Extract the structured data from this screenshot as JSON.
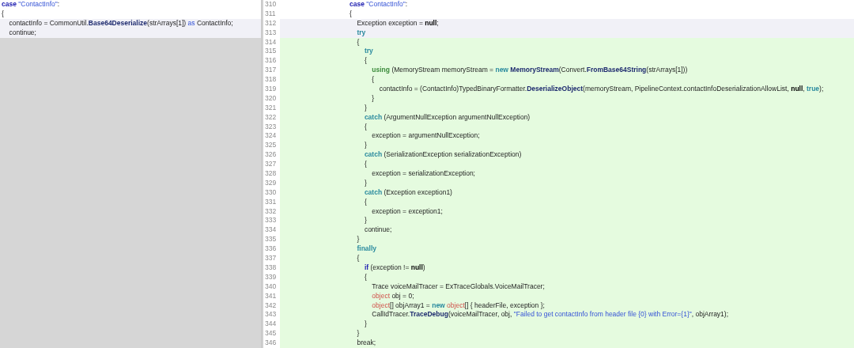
{
  "left": {
    "lines": [
      {
        "added": false,
        "changed": false,
        "tokens": [
          {
            "kind": "keyword",
            "text": "case"
          },
          {
            "kind": "string",
            "text": " \"ContactInfo\""
          },
          {
            "kind": "plain",
            "text": ":"
          }
        ]
      },
      {
        "added": false,
        "changed": false,
        "tokens": [
          {
            "kind": "plain",
            "text": "{"
          }
        ]
      },
      {
        "added": false,
        "changed": true,
        "tokens": [
          {
            "kind": "plain",
            "text": "    contactInfo = CommonUtil."
          },
          {
            "kind": "method",
            "text": "Base64Deserialize"
          },
          {
            "kind": "plain",
            "text": "(strArrays[1]) "
          },
          {
            "kind": "keyword-light",
            "text": "as"
          },
          {
            "kind": "plain",
            "text": " ContactInfo;"
          }
        ]
      },
      {
        "added": false,
        "changed": true,
        "tokens": [
          {
            "kind": "plain",
            "text": "    continue;"
          }
        ]
      }
    ]
  },
  "right": {
    "lines": [
      {
        "number": "310",
        "added": false,
        "changed": false,
        "tokens": [
          {
            "kind": "keyword",
            "text": "case"
          },
          {
            "kind": "string",
            "text": " \"ContactInfo\""
          },
          {
            "kind": "plain",
            "text": ":"
          }
        ]
      },
      {
        "number": "311",
        "added": false,
        "changed": false,
        "tokens": [
          {
            "kind": "plain",
            "text": "{"
          }
        ]
      },
      {
        "number": "312",
        "added": false,
        "changed": true,
        "tokens": [
          {
            "kind": "plain",
            "text": "    Exception exception = "
          },
          {
            "kind": "literal",
            "text": "null"
          },
          {
            "kind": "plain",
            "text": ";"
          }
        ]
      },
      {
        "number": "313",
        "added": false,
        "changed": true,
        "tokens": [
          {
            "kind": "control",
            "text": "    try"
          }
        ]
      },
      {
        "number": "314",
        "added": true,
        "changed": false,
        "tokens": [
          {
            "kind": "plain",
            "text": "    {"
          }
        ]
      },
      {
        "number": "315",
        "added": true,
        "changed": false,
        "tokens": [
          {
            "kind": "control",
            "text": "        try"
          }
        ]
      },
      {
        "number": "316",
        "added": true,
        "changed": false,
        "tokens": [
          {
            "kind": "plain",
            "text": "        {"
          }
        ]
      },
      {
        "number": "317",
        "added": true,
        "changed": false,
        "tokens": [
          {
            "kind": "using",
            "text": "            using"
          },
          {
            "kind": "plain",
            "text": " (MemoryStream memoryStream = "
          },
          {
            "kind": "control",
            "text": "new"
          },
          {
            "kind": "method",
            "text": " MemoryStream"
          },
          {
            "kind": "plain",
            "text": "(Convert."
          },
          {
            "kind": "method",
            "text": "FromBase64String"
          },
          {
            "kind": "plain",
            "text": "(strArrays[1]))"
          }
        ]
      },
      {
        "number": "318",
        "added": true,
        "changed": false,
        "tokens": [
          {
            "kind": "plain",
            "text": "            {"
          }
        ]
      },
      {
        "number": "319",
        "added": true,
        "changed": false,
        "tokens": [
          {
            "kind": "plain",
            "text": "                contactInfo = (ContactInfo)TypedBinaryFormatter."
          },
          {
            "kind": "method",
            "text": "DeserializeObject"
          },
          {
            "kind": "plain",
            "text": "(memoryStream, PipelineContext.contactInfoDeserializationAllowList, "
          },
          {
            "kind": "literal",
            "text": "null"
          },
          {
            "kind": "plain",
            "text": ","
          },
          {
            "kind": "control",
            "text": " true"
          },
          {
            "kind": "plain",
            "text": ");"
          }
        ]
      },
      {
        "number": "320",
        "added": true,
        "changed": false,
        "tokens": [
          {
            "kind": "plain",
            "text": "            }"
          }
        ]
      },
      {
        "number": "321",
        "added": true,
        "changed": false,
        "tokens": [
          {
            "kind": "plain",
            "text": "        }"
          }
        ]
      },
      {
        "number": "322",
        "added": true,
        "changed": false,
        "tokens": [
          {
            "kind": "control",
            "text": "        catch"
          },
          {
            "kind": "plain",
            "text": " (ArgumentNullException argumentNullException)"
          }
        ]
      },
      {
        "number": "323",
        "added": true,
        "changed": false,
        "tokens": [
          {
            "kind": "plain",
            "text": "        {"
          }
        ]
      },
      {
        "number": "324",
        "added": true,
        "changed": false,
        "tokens": [
          {
            "kind": "plain",
            "text": "            exception = argumentNullException;"
          }
        ]
      },
      {
        "number": "325",
        "added": true,
        "changed": false,
        "tokens": [
          {
            "kind": "plain",
            "text": "        }"
          }
        ]
      },
      {
        "number": "326",
        "added": true,
        "changed": false,
        "tokens": [
          {
            "kind": "control",
            "text": "        catch"
          },
          {
            "kind": "plain",
            "text": " (SerializationException serializationException)"
          }
        ]
      },
      {
        "number": "327",
        "added": true,
        "changed": false,
        "tokens": [
          {
            "kind": "plain",
            "text": "        {"
          }
        ]
      },
      {
        "number": "328",
        "added": true,
        "changed": false,
        "tokens": [
          {
            "kind": "plain",
            "text": "            exception = serializationException;"
          }
        ]
      },
      {
        "number": "329",
        "added": true,
        "changed": false,
        "tokens": [
          {
            "kind": "plain",
            "text": "        }"
          }
        ]
      },
      {
        "number": "330",
        "added": true,
        "changed": false,
        "tokens": [
          {
            "kind": "control",
            "text": "        catch"
          },
          {
            "kind": "plain",
            "text": " (Exception exception1)"
          }
        ]
      },
      {
        "number": "331",
        "added": true,
        "changed": false,
        "tokens": [
          {
            "kind": "plain",
            "text": "        {"
          }
        ]
      },
      {
        "number": "332",
        "added": true,
        "changed": false,
        "tokens": [
          {
            "kind": "plain",
            "text": "            exception = exception1;"
          }
        ]
      },
      {
        "number": "333",
        "added": true,
        "changed": false,
        "tokens": [
          {
            "kind": "plain",
            "text": "        }"
          }
        ]
      },
      {
        "number": "334",
        "added": true,
        "changed": false,
        "tokens": [
          {
            "kind": "plain",
            "text": "        continue;"
          }
        ]
      },
      {
        "number": "335",
        "added": true,
        "changed": false,
        "tokens": [
          {
            "kind": "plain",
            "text": "    }"
          }
        ]
      },
      {
        "number": "336",
        "added": true,
        "changed": false,
        "tokens": [
          {
            "kind": "control",
            "text": "    finally"
          }
        ]
      },
      {
        "number": "337",
        "added": true,
        "changed": false,
        "tokens": [
          {
            "kind": "plain",
            "text": "    {"
          }
        ]
      },
      {
        "number": "338",
        "added": true,
        "changed": false,
        "tokens": [
          {
            "kind": "keyword",
            "text": "        if"
          },
          {
            "kind": "plain",
            "text": " (exception != "
          },
          {
            "kind": "literal",
            "text": "null"
          },
          {
            "kind": "plain",
            "text": ")"
          }
        ]
      },
      {
        "number": "339",
        "added": true,
        "changed": false,
        "tokens": [
          {
            "kind": "plain",
            "text": "        {"
          }
        ]
      },
      {
        "number": "340",
        "added": true,
        "changed": false,
        "tokens": [
          {
            "kind": "plain",
            "text": "            Trace voiceMailTracer = ExTraceGlobals.VoiceMailTracer;"
          }
        ]
      },
      {
        "number": "341",
        "added": true,
        "changed": false,
        "tokens": [
          {
            "kind": "type",
            "text": "            object"
          },
          {
            "kind": "plain",
            "text": " obj = 0;"
          }
        ]
      },
      {
        "number": "342",
        "added": true,
        "changed": false,
        "tokens": [
          {
            "kind": "type",
            "text": "            object"
          },
          {
            "kind": "plain",
            "text": "[] objArray1 = "
          },
          {
            "kind": "control",
            "text": "new"
          },
          {
            "kind": "type",
            "text": " object"
          },
          {
            "kind": "plain",
            "text": "[] { headerFile, exception };"
          }
        ]
      },
      {
        "number": "343",
        "added": true,
        "changed": false,
        "tokens": [
          {
            "kind": "plain",
            "text": "            CallIdTracer."
          },
          {
            "kind": "method",
            "text": "TraceDebug"
          },
          {
            "kind": "plain",
            "text": "(voiceMailTracer, obj, "
          },
          {
            "kind": "string",
            "text": "\"Failed to get contactInfo from header file {0} with Error={1}\""
          },
          {
            "kind": "plain",
            "text": ", objArray1);"
          }
        ]
      },
      {
        "number": "344",
        "added": true,
        "changed": false,
        "tokens": [
          {
            "kind": "plain",
            "text": "        }"
          }
        ]
      },
      {
        "number": "345",
        "added": true,
        "changed": false,
        "tokens": [
          {
            "kind": "plain",
            "text": "    }"
          }
        ]
      },
      {
        "number": "346",
        "added": true,
        "changed": false,
        "tokens": [
          {
            "kind": "plain",
            "text": "    break;"
          }
        ]
      }
    ]
  }
}
